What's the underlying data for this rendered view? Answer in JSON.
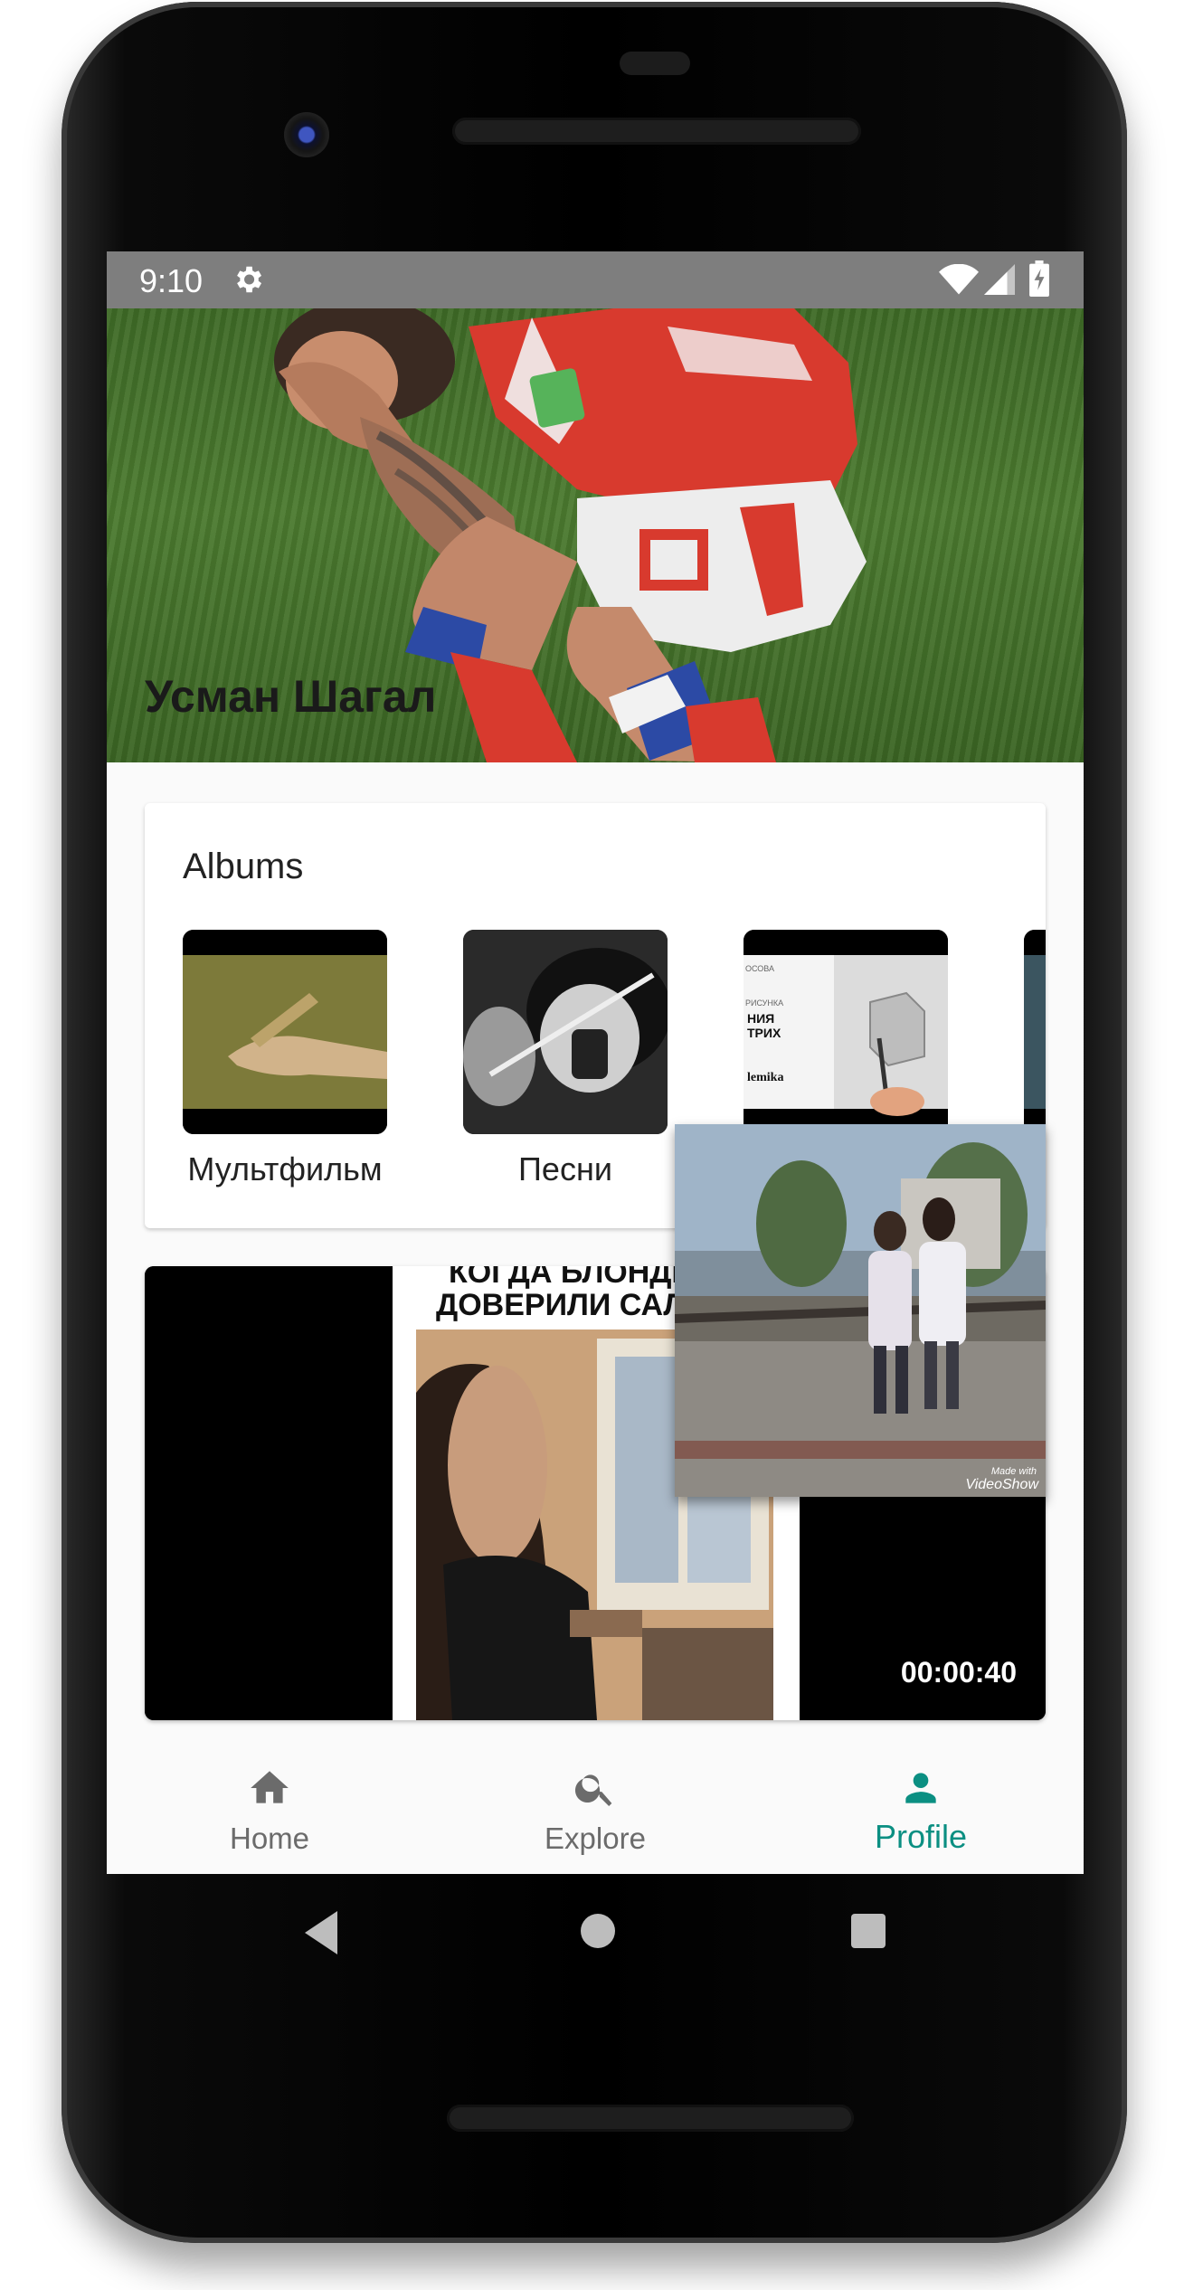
{
  "status_bar": {
    "time": "9:10",
    "icons": [
      "gear-icon",
      "wifi-icon",
      "signal-icon",
      "battery-charging-icon"
    ]
  },
  "profile": {
    "name": "Усман Шагал"
  },
  "albums": {
    "title": "Albums",
    "items": [
      {
        "label": "Мультфильм",
        "thumb": "cartoon-hands"
      },
      {
        "label": "Песни",
        "thumb": "bw-singer"
      },
      {
        "label": "",
        "thumb": "drawing-lesson",
        "thumb_text": [
          "ОСОВА",
          "РИСУНКА",
          "НИЯ",
          "ТРИХ",
          "lemika"
        ]
      },
      {
        "label": "",
        "thumb": "partial"
      }
    ]
  },
  "video": {
    "caption_line1": "КОГДА БЛОНДИ",
    "caption_line2": "ДОВЕРИЛИ САЛ",
    "duration": "00:00:40"
  },
  "floating_video": {
    "watermark_small": "Made with",
    "watermark": "VideoShow"
  },
  "bottom_nav": {
    "items": [
      {
        "label": "Home",
        "icon": "home-icon",
        "active": false
      },
      {
        "label": "Explore",
        "icon": "search-icon",
        "active": false
      },
      {
        "label": "Profile",
        "icon": "person-icon",
        "active": true
      }
    ]
  },
  "colors": {
    "accent": "#0b8f82",
    "status_bar": "#7e7e7e",
    "nav_inactive": "#6b6b6b"
  },
  "system_nav": [
    "back-icon",
    "home-circle-icon",
    "recents-icon"
  ]
}
